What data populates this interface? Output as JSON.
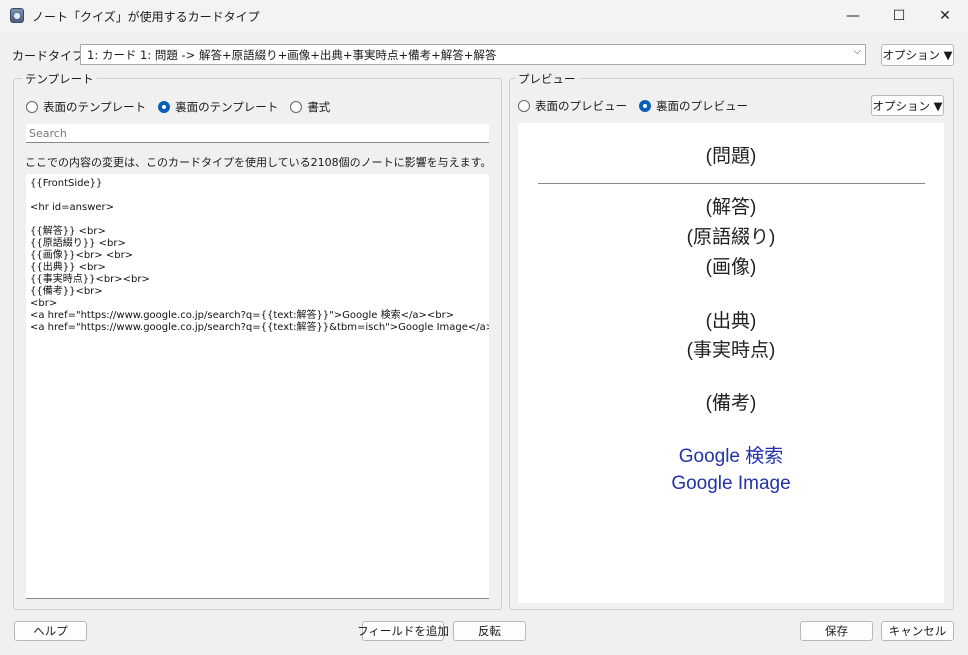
{
  "window": {
    "title": "ノート「クイズ」が使用するカードタイプ",
    "minimize": "—",
    "maximize": "☐",
    "close": "✕"
  },
  "cardtype": {
    "label": "カードタイプ:",
    "selected": "1: カード 1: 問題 -> 解答+原語綴り+画像+出典+事実時点+備考+解答+解答",
    "options_button": "オプション ▼"
  },
  "template": {
    "group_title": "テンプレート",
    "radios": [
      {
        "label": "表面のテンプレート",
        "checked": false
      },
      {
        "label": "裏面のテンプレート",
        "checked": true
      },
      {
        "label": "書式",
        "checked": false
      }
    ],
    "search_placeholder": "Search",
    "notice": "ここでの内容の変更は、このカードタイプを使用している2108個のノートに影響を与えます。",
    "code": "{{FrontSide}}\n\n<hr id=answer>\n\n{{解答}} <br>\n{{原語綴り}} <br>\n{{画像}}<br> <br>\n{{出典}} <br>\n{{事実時点}}<br><br>\n{{備考}}<br>\n<br>\n<a href=\"https://www.google.co.jp/search?q={{text:解答}}\">Google 検索</a><br>\n<a href=\"https://www.google.co.jp/search?q={{text:解答}}&tbm=isch\">Google Image</a>"
  },
  "preview": {
    "group_title": "プレビュー",
    "radios": [
      {
        "label": "表面のプレビュー",
        "checked": false
      },
      {
        "label": "裏面のプレビュー",
        "checked": true
      }
    ],
    "options_button": "オプション ▼",
    "question": "(問題)",
    "answer": "(解答)",
    "original_spelling": "(原語綴り)",
    "image": "(画像)",
    "source": "(出典)",
    "fact_time": "(事実時点)",
    "remarks": "(備考)",
    "link_search": "Google 検索",
    "link_image": "Google Image"
  },
  "footer": {
    "help": "ヘルプ",
    "add_field": "フィールドを追加",
    "flip": "反転",
    "save": "保存",
    "cancel": "キャンセル"
  }
}
